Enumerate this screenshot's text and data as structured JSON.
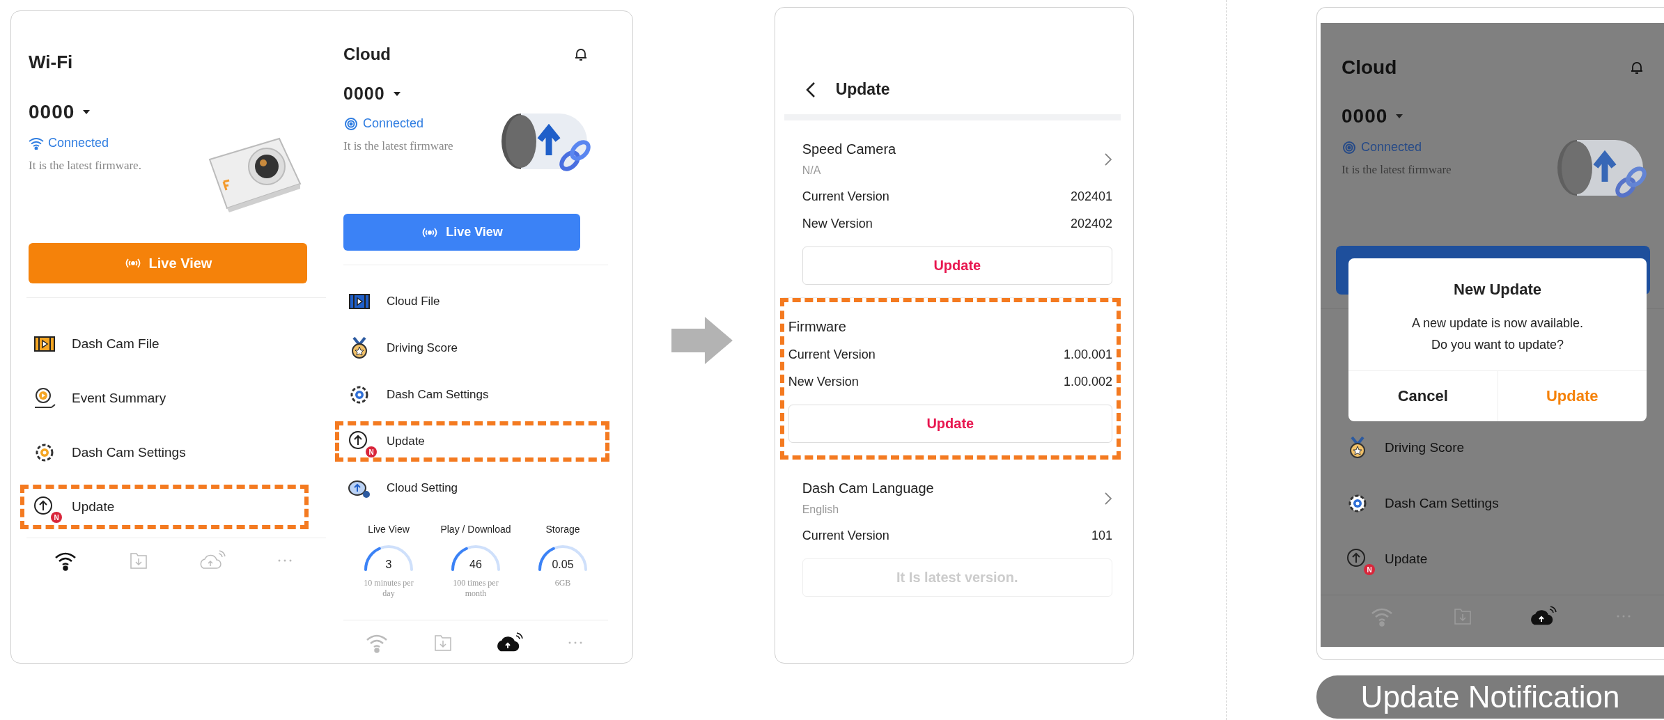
{
  "wifi_screen": {
    "title": "Wi-Fi",
    "device": "0000",
    "status": "Connected",
    "firmware_note": "It is the latest firmware.",
    "live_view": "Live View",
    "menu": [
      {
        "kind": "file",
        "label": "Dash Cam File",
        "highlighted": false
      },
      {
        "kind": "event",
        "label": "Event Summary",
        "highlighted": false
      },
      {
        "kind": "settings",
        "label": "Dash Cam Settings",
        "highlighted": false
      },
      {
        "kind": "update",
        "label": "Update",
        "badge": "N",
        "highlighted": true
      }
    ],
    "nav": [
      {
        "kind": "wifi",
        "selected": true
      },
      {
        "kind": "download",
        "selected": false
      },
      {
        "kind": "cloud",
        "selected": false
      },
      {
        "kind": "more",
        "selected": false
      }
    ]
  },
  "cloud_screen": {
    "title": "Cloud",
    "device": "0000",
    "status": "Connected",
    "firmware_note": "It is the latest firmware",
    "live_view": "Live View",
    "menu": [
      {
        "kind": "file",
        "label": "Cloud File",
        "highlighted": false
      },
      {
        "kind": "score",
        "label": "Driving Score",
        "highlighted": false
      },
      {
        "kind": "settings",
        "label": "Dash Cam Settings",
        "highlighted": false
      },
      {
        "kind": "update",
        "label": "Update",
        "badge": "N",
        "highlighted": true
      },
      {
        "kind": "cloud-setting",
        "label": "Cloud Setting",
        "highlighted": false
      }
    ],
    "usage": [
      {
        "label": "Live View",
        "value": "3",
        "note": "10 minutes per day",
        "level": 0.3
      },
      {
        "label": "Play / Download",
        "value": "46",
        "note": "100 times per month",
        "level": 0.3
      },
      {
        "label": "Storage",
        "value": "0.05",
        "note": "6GB",
        "level": 0.3
      }
    ],
    "nav": [
      {
        "kind": "wifi",
        "selected": false
      },
      {
        "kind": "download",
        "selected": false
      },
      {
        "kind": "cloud",
        "selected": true
      },
      {
        "kind": "more",
        "selected": false
      }
    ]
  },
  "update_screen": {
    "title": "Update",
    "sections": [
      {
        "title": "Speed Camera",
        "subtitle": "N/A",
        "has_details": true,
        "highlighted": false,
        "rows": [
          {
            "label": "Current Version",
            "value": "202401"
          },
          {
            "label": "New Version",
            "value": "202402"
          }
        ],
        "button": {
          "label": "Update",
          "disabled": false
        }
      },
      {
        "title": "Firmware",
        "has_details": false,
        "highlighted": true,
        "rows": [
          {
            "label": "Current Version",
            "value": "1.00.001"
          },
          {
            "label": "New Version",
            "value": "1.00.002"
          }
        ],
        "button": {
          "label": "Update",
          "disabled": false
        }
      },
      {
        "title": "Dash Cam Language",
        "subtitle": "English",
        "has_details": true,
        "highlighted": false,
        "rows": [
          {
            "label": "Current Version",
            "value": "101"
          }
        ],
        "button": {
          "label": "It Is latest version.",
          "disabled": true
        }
      }
    ]
  },
  "notification_screen": {
    "title": "Cloud",
    "device": "0000",
    "status": "Connected",
    "firmware_note": "It is the latest firmware",
    "menu": [
      {
        "kind": "score",
        "label": "Driving Score"
      },
      {
        "kind": "settings",
        "label": "Dash Cam Settings"
      },
      {
        "kind": "update",
        "label": "Update",
        "badge": "N"
      }
    ],
    "nav": [
      {
        "kind": "wifi",
        "selected": false
      },
      {
        "kind": "download",
        "selected": false
      },
      {
        "kind": "cloud",
        "selected": true
      },
      {
        "kind": "more",
        "selected": false
      }
    ],
    "dialog": {
      "title": "New Update",
      "message": [
        "A new update is now available.",
        "Do you want to update?"
      ],
      "buttons": [
        {
          "label": "Cancel",
          "kind": "cancel"
        },
        {
          "label": "Update",
          "kind": "confirm"
        }
      ]
    }
  },
  "caption": "Update Notification"
}
